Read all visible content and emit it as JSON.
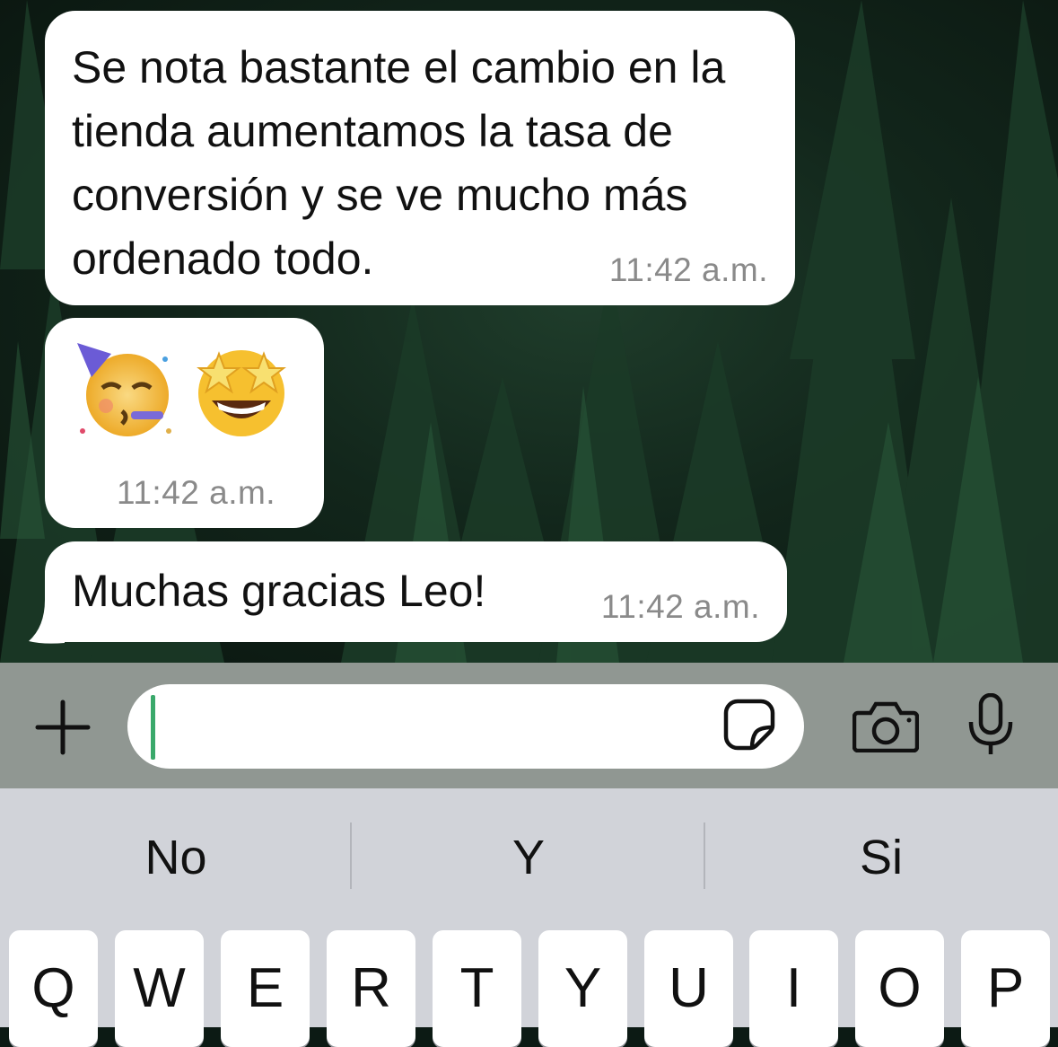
{
  "messages": [
    {
      "text": "Se nota bastante el cambio en la tienda aumentamos la tasa de conversión y se ve mucho más ordenado todo.",
      "time": "11:42 a.m."
    },
    {
      "emojis": [
        "partying-face-emoji",
        "star-struck-emoji"
      ],
      "time": "11:42 a.m."
    },
    {
      "text": "Muchas gracias Leo!",
      "time": "11:42 a.m."
    }
  ],
  "input_bar": {
    "value": "",
    "icons": [
      "plus-icon",
      "sticker-icon",
      "camera-icon",
      "microphone-icon"
    ]
  },
  "keyboard": {
    "suggestions": [
      "No",
      "Y",
      "Si"
    ],
    "row1": [
      "Q",
      "W",
      "E",
      "R",
      "T",
      "Y",
      "U",
      "I",
      "O",
      "P"
    ]
  },
  "colors": {
    "bubble": "#ffffff",
    "input_bar": "#909792",
    "keyboard": "#d1d3d9",
    "cursor": "#3aa96b",
    "timestamp": "#8a8a8a"
  }
}
